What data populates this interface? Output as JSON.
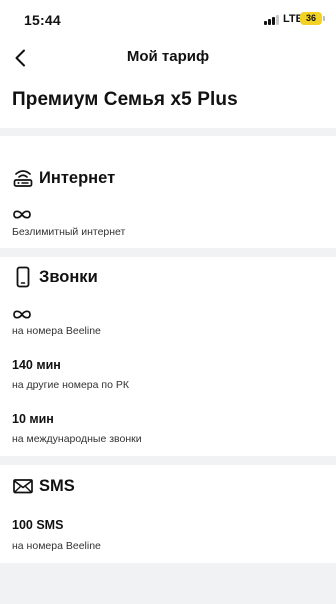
{
  "status_bar": {
    "time": "15:44",
    "network": "LTE",
    "battery": "36"
  },
  "nav": {
    "title": "Мой тариф"
  },
  "plan": {
    "name": "Премиум Семья x5 Plus"
  },
  "sections": {
    "internet": {
      "title": "Интернет",
      "items": [
        {
          "value": "∞",
          "caption": "Безлимитный интернет"
        }
      ]
    },
    "calls": {
      "title": "Звонки",
      "items": [
        {
          "value": "∞",
          "caption": "на номера Beeline"
        },
        {
          "value": "140 мин",
          "caption": "на другие номера по РК"
        },
        {
          "value": "10 мин",
          "caption": "на международные звонки"
        }
      ]
    },
    "sms": {
      "title": "SMS",
      "items": [
        {
          "value": "100 SMS",
          "caption": "на номера Beeline"
        }
      ]
    }
  },
  "icons": {
    "back": "chevron-left-icon",
    "internet": "router-icon",
    "calls": "smartphone-icon",
    "sms": "envelope-icon",
    "unlimited": "infinity-icon"
  }
}
